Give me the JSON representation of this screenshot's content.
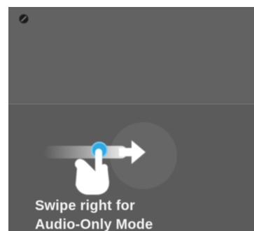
{
  "hint": {
    "text": "Swipe right for\nAudio-Only Mode"
  },
  "icons": {
    "corner": "no-video-icon",
    "gesture_hand": "hand-pointer-icon",
    "gesture_arrow": "arrow-right-icon"
  },
  "colors": {
    "panel": "#5e5e5e",
    "accent_dot": "#2fa8e6",
    "hand": "#ffffff"
  }
}
